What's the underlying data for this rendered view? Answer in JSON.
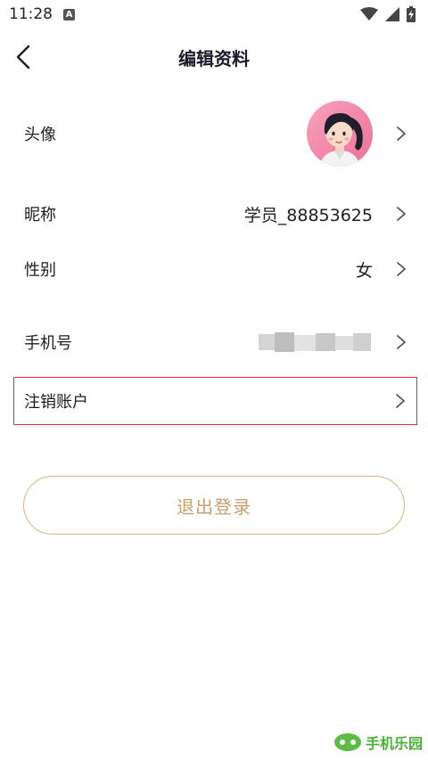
{
  "status_bar": {
    "time": "11:28",
    "notification_badge": "A"
  },
  "header": {
    "title": "编辑资料"
  },
  "profile": {
    "avatar_label": "头像",
    "nickname_label": "昵称",
    "nickname_value": "学员_88853625",
    "gender_label": "性别",
    "gender_value": "女",
    "phone_label": "手机号",
    "cancel_account_label": "注销账户"
  },
  "logout_label": "退出登录",
  "watermark": {
    "text": "手机乐园"
  },
  "colors": {
    "accent_gold": "#c9a06b",
    "highlight_red": "#d6322c",
    "avatar_bg": "#f38aa8"
  }
}
